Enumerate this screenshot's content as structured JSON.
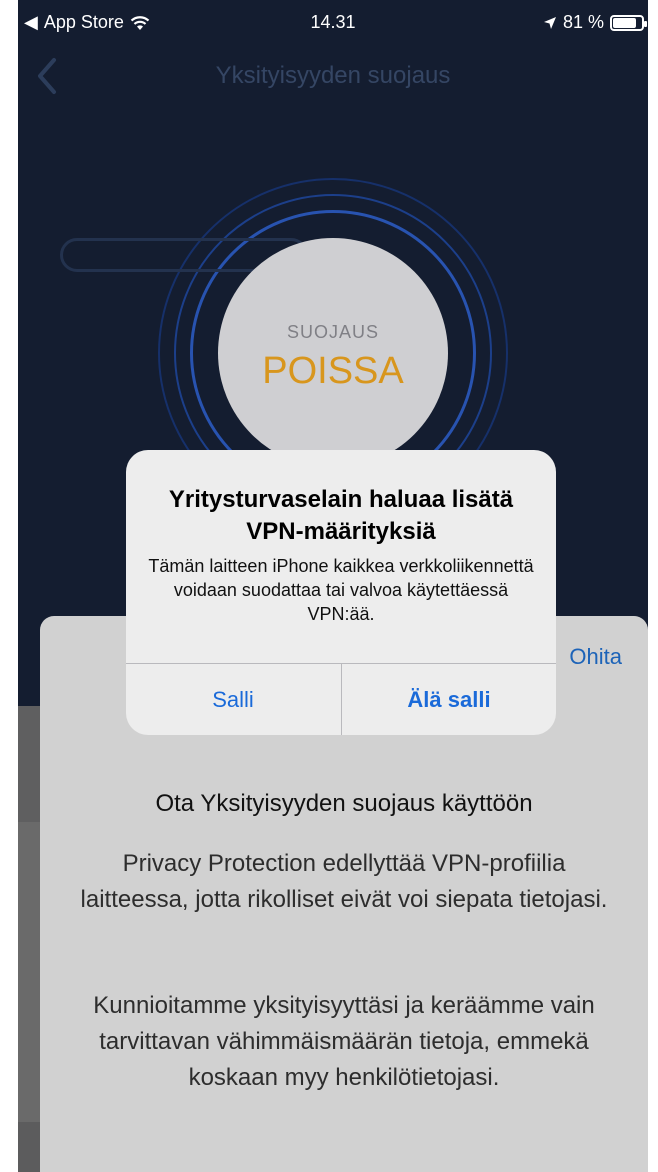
{
  "status_bar": {
    "back_app": "App Store",
    "time": "14.31",
    "battery": "81 %",
    "battery_level": 0.81
  },
  "nav": {
    "title": "Yksityisyyden suojaus"
  },
  "protection": {
    "label": "SUOJAUS",
    "status": "POISSA"
  },
  "sheet": {
    "skip_label": "Ohita",
    "title": "Ota Yksityisyyden suojaus käyttöön",
    "paragraph1": "Privacy Protection edellyttää VPN-profiilia laitteessa, jotta rikolliset eivät voi siepata tietojasi.",
    "paragraph2": "Kunnioitamme yksityisyyttäsi ja keräämme vain tarvittavan vähimmäismäärän tietoja, emmekä koskaan myy henkilötietojasi."
  },
  "alert": {
    "title": "Yritysturvaselain haluaa lisätä VPN-määrityksiä",
    "message": "Tämän laitteen iPhone kaikkea verkkoliikennettä voidaan suodattaa tai valvoa käytettäessä VPN:ää.",
    "allow_label": "Salli",
    "deny_label": "Älä salli"
  },
  "colors": {
    "background": "#141d30",
    "status_off": "#d8961d",
    "link_blue": "#1a6ad9"
  }
}
